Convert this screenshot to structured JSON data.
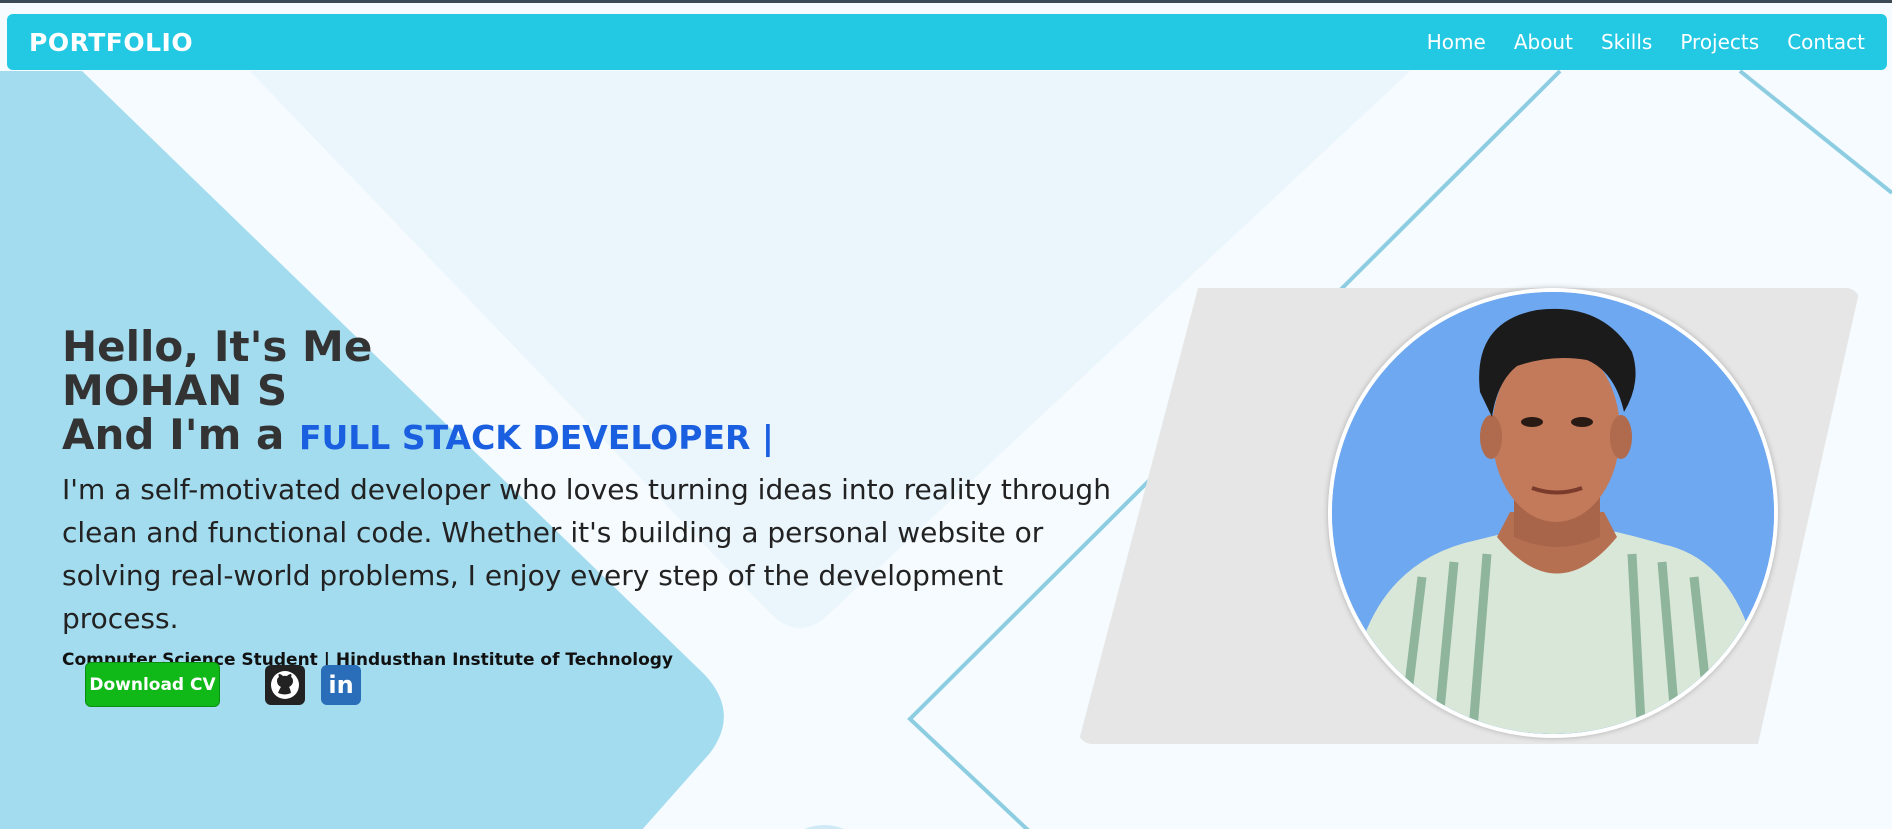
{
  "navbar": {
    "logo": "PORTFOLIO",
    "links": [
      "Home",
      "About",
      "Skills",
      "Projects",
      "Contact"
    ]
  },
  "hero": {
    "greeting": "Hello, It's Me",
    "name": "MOHAN S",
    "role_prefix": "And I'm a",
    "role": "FULL STACK DEVELOPER |",
    "bio": "I'm a self-motivated developer who loves turning ideas into reality through clean and functional code. Whether it's building a personal website or solving real-world problems, I enjoy every step of the development process.",
    "subtitle": "Computer Science Student | Hindusthan Institute of Technology",
    "cv_button": "Download CV",
    "linkedin_label": "in"
  },
  "icons": [
    "github-icon",
    "linkedin-icon"
  ],
  "colors": {
    "navbar": "#23c8e3",
    "accent_blue": "#1a5fe0",
    "download_button": "#10b918",
    "background_shape": "#a3dcef",
    "avatar_background": "#6ea8f0"
  }
}
